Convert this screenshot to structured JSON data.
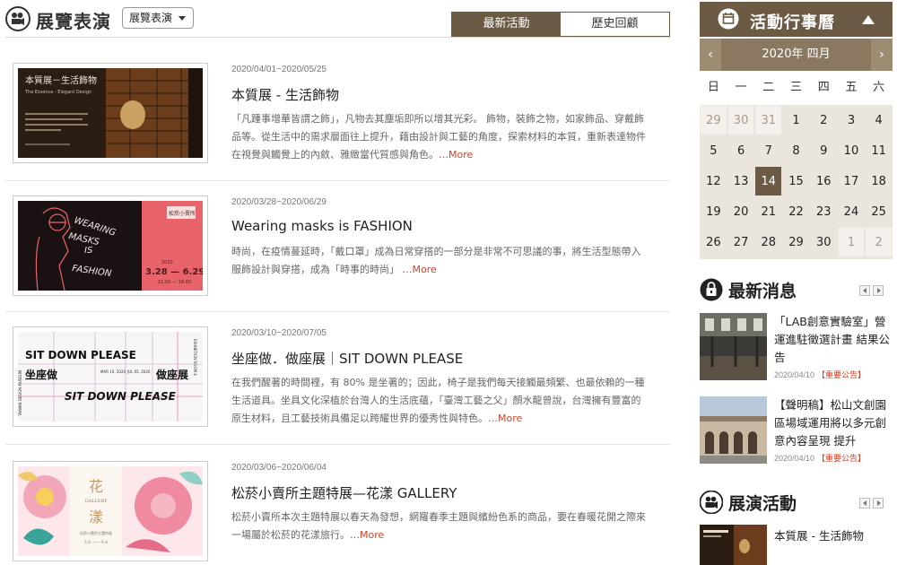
{
  "header": {
    "title": "展覽表演",
    "select_value": "展覽表演",
    "tabs": [
      {
        "label": "最新活動",
        "active": true
      },
      {
        "label": "歷史回顧",
        "active": false
      }
    ]
  },
  "articles": [
    {
      "date": "2020/04/01~2020/05/25",
      "title": "本質展 - 生活飾物",
      "desc": "「凡踵事增華皆謂之飾」，凡物去其塵垢即所以增其光彩。 飾物，裝飾之物，如家飾品、穿戴飾品等。從生活中的需求層面往上提升，藉由設計與工藝的角度，探索材料的本質，重新表達物件在視覺與觸覺上的內斂、雅緻當代質感與角色。",
      "more": "…More",
      "poster": {
        "title": "本質展－生活飾物",
        "subtitle": "The Essence - Elegant Design"
      }
    },
    {
      "date": "2020/03/28~2020/06/29",
      "title": "Wearing masks is FASHION",
      "desc": "時尚，在疫情蔓延時，「戴口罩」成為日常穿搭的一部分是非常不可思議的事，將生活型態帶入服飾設計與穿搭，成為「時事的時尚」",
      "more": "…More",
      "poster": {
        "words": [
          "WEARING",
          "MASKS",
          "IS",
          "FASHION"
        ],
        "year": "2020",
        "dates": "3.28 — 6.29",
        "hours": "11:00 — 18:00",
        "badge": "松菸小賣所"
      }
    },
    {
      "date": "2020/03/10~2020/07/05",
      "title": "坐座做．做座展｜SIT DOWN PLEASE",
      "desc": "在我們醒著的時間裡，有 80% 是坐著的；因此，椅子是我們每天接觸最頻繁、也最依賴的一種生活道具。坐具文化深植於台灣人的生活底蘊，「臺灣工藝之父」顏水龍曾說，台灣擁有豐富的原生材料，且工藝技術具備足以跨耀世界的優秀性與特色。",
      "more": "…More",
      "poster": {
        "line1": "SIT DOWN PLEASE",
        "line2": "SIT DOWN PLEASE",
        "cn_left": "坐座做",
        "cn_right": "做座展",
        "d1": "MAR 10, 2020",
        "d2": "JUL 05, 2020",
        "side_left": "TAIWAN DESIGN MUSEUM",
        "side_right": "EXHIBITION ROOM 4"
      }
    },
    {
      "date": "2020/03/06~2020/06/04",
      "title": "松菸小賣所主題特展—花漾 GALLERY",
      "desc": "松菸小賣所本次主題特展以春天為發想，網羅春季主題與繽紛色系的商品，要在春暖花開之際來一場屬於松菸的花漾旅行。",
      "more": "…More",
      "poster": {
        "char1": "花",
        "label": "GALLERY",
        "char2": "漾",
        "sub": "松菸小賣所主題特展",
        "dates": "3.6 —— 6.4"
      }
    }
  ],
  "calendar": {
    "title": "活動行事曆",
    "month": "2020年 四月",
    "prev": "‹",
    "next": "›",
    "weekdays": [
      "日",
      "一",
      "二",
      "三",
      "四",
      "五",
      "六"
    ],
    "today": 14,
    "weeks": [
      [
        {
          "d": "29",
          "other": true
        },
        {
          "d": "30",
          "other": true
        },
        {
          "d": "31",
          "other": true
        },
        {
          "d": "1"
        },
        {
          "d": "2"
        },
        {
          "d": "3"
        },
        {
          "d": "4"
        }
      ],
      [
        {
          "d": "5"
        },
        {
          "d": "6"
        },
        {
          "d": "7"
        },
        {
          "d": "8"
        },
        {
          "d": "9"
        },
        {
          "d": "10"
        },
        {
          "d": "11"
        }
      ],
      [
        {
          "d": "12"
        },
        {
          "d": "13"
        },
        {
          "d": "14"
        },
        {
          "d": "15"
        },
        {
          "d": "16"
        },
        {
          "d": "17"
        },
        {
          "d": "18"
        }
      ],
      [
        {
          "d": "19"
        },
        {
          "d": "20"
        },
        {
          "d": "21"
        },
        {
          "d": "22"
        },
        {
          "d": "23"
        },
        {
          "d": "24"
        },
        {
          "d": "25"
        }
      ],
      [
        {
          "d": "26"
        },
        {
          "d": "27"
        },
        {
          "d": "28"
        },
        {
          "d": "29"
        },
        {
          "d": "30"
        },
        {
          "d": "1",
          "other": true
        },
        {
          "d": "2",
          "other": true
        }
      ]
    ]
  },
  "news": {
    "title": "最新消息",
    "items": [
      {
        "text": "「LAB創意實驗室」營運進駐徵選計畫 結果公告",
        "date": "2020/04/10",
        "tag": "【重要公告】"
      },
      {
        "text": "【聲明稿】松山文創園區場域運用將以多元創意內容呈現 提升",
        "date": "2020/04/10",
        "tag": "【重要公告】"
      }
    ]
  },
  "events": {
    "title": "展演活動",
    "items": [
      {
        "title": "本質展 - 生活飾物"
      }
    ]
  }
}
